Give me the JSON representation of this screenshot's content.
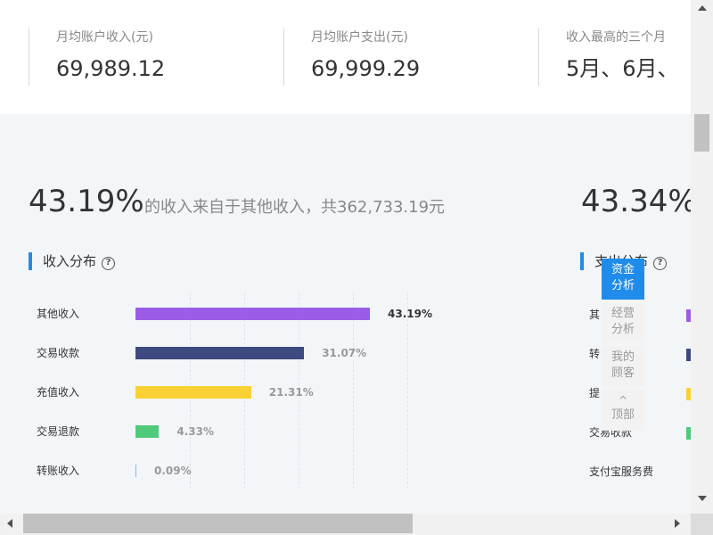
{
  "stats": [
    {
      "label": "月均账户收入(元)",
      "value": "69,989.12"
    },
    {
      "label": "月均账户支出(元)",
      "value": "69,999.29"
    },
    {
      "label": "收入最高的三个月",
      "value": "5月、6月、"
    }
  ],
  "income": {
    "big_pct": "43.19%",
    "description": "的收入来自于其他收入，共362,733.19元",
    "section_title": "收入分布",
    "help_icon": "?"
  },
  "expense": {
    "big_pct": "43.34%",
    "section_title_partial": "支出分布",
    "help_icon": "?",
    "visible_categories": [
      "其",
      "转",
      "提",
      "交易收款",
      "支付宝服务费"
    ]
  },
  "chart_data": {
    "type": "bar",
    "orientation": "horizontal",
    "categories": [
      "其他收入",
      "交易收款",
      "充值收入",
      "交易退款",
      "转账收入"
    ],
    "values": [
      43.19,
      31.07,
      21.31,
      4.33,
      0.09
    ],
    "labels": [
      "43.19%",
      "31.07%",
      "21.31%",
      "4.33%",
      "0.09%"
    ],
    "colors": [
      "#9b5de5",
      "#3d4a7f",
      "#f9d134",
      "#4fc97a",
      "#7fb7ee"
    ],
    "xlim": [
      0,
      50
    ],
    "grid": true
  },
  "floatnav": [
    {
      "line1": "资金",
      "line2": "分析",
      "active": true
    },
    {
      "line1": "经营",
      "line2": "分析",
      "active": false
    },
    {
      "line1": "我的",
      "line2": "顾客",
      "active": false
    },
    {
      "line1": "^",
      "line2": "顶部",
      "active": false
    }
  ]
}
